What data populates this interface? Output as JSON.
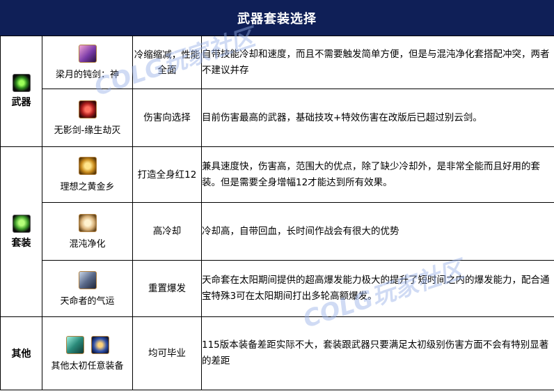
{
  "title": "武器套装选择",
  "watermark": "COLG玩家社区",
  "colors": {
    "header_bg": "#0f1f57",
    "header_text": "#ffffff",
    "border": "#000000"
  },
  "categories": [
    {
      "label": "武器",
      "icon": "green-sword-icon",
      "rows": [
        {
          "name": "梁月的钝剑：神",
          "icons": [
            "pink-blade-icon"
          ],
          "tag": "冷缩缩减，性能全面",
          "desc": "自带技能冷却和速度，而且不需要触发简单方便，但是与混沌净化套搭配冲突，两者不建议并存"
        },
        {
          "name": "无影剑-缘生劫灭",
          "icons": [
            "red-sword-icon"
          ],
          "tag": "伤害向选择",
          "desc": "目前伤害最高的武器，基础技攻+特效伤害在改版后已超过别云剑。"
        }
      ]
    },
    {
      "label": "套装",
      "icon": "green-armor-icon",
      "rows": [
        {
          "name": "理想之黄金乡",
          "icons": [
            "gold-armor-icon"
          ],
          "tag": "打造全身红12",
          "desc": "兼具速度快，伤害高，范围大的优点，除了缺少冷却外，是非常全能而且好用的套装。但是需要全身增幅12才能达到所有效果。"
        },
        {
          "name": "混沌净化",
          "icons": [
            "cream-armor-icon"
          ],
          "tag": "高冷却",
          "desc": "冷却高，自带回血，长时间作战会有很大的优势"
        },
        {
          "name": "天命者的气运",
          "icons": [
            "steel-gauntlet-icon"
          ],
          "tag": "重置爆发",
          "desc": "天命套在太阳期间提供的超高爆发能力极大的提升了短时间之内的爆发能力，配合通宝特殊3可在太阳期间打出多轮高额爆发。"
        }
      ]
    },
    {
      "label": "其他",
      "icon": "",
      "rows": [
        {
          "name": "其他太初任意装备",
          "icons": [
            "teal-weapon-icon",
            "blue-armor-icon"
          ],
          "tag": "均可毕业",
          "desc": "115版本装备差距实际不大，套装跟武器只要满足太初级别伤害方面不会有特别显著的差距"
        }
      ]
    }
  ]
}
